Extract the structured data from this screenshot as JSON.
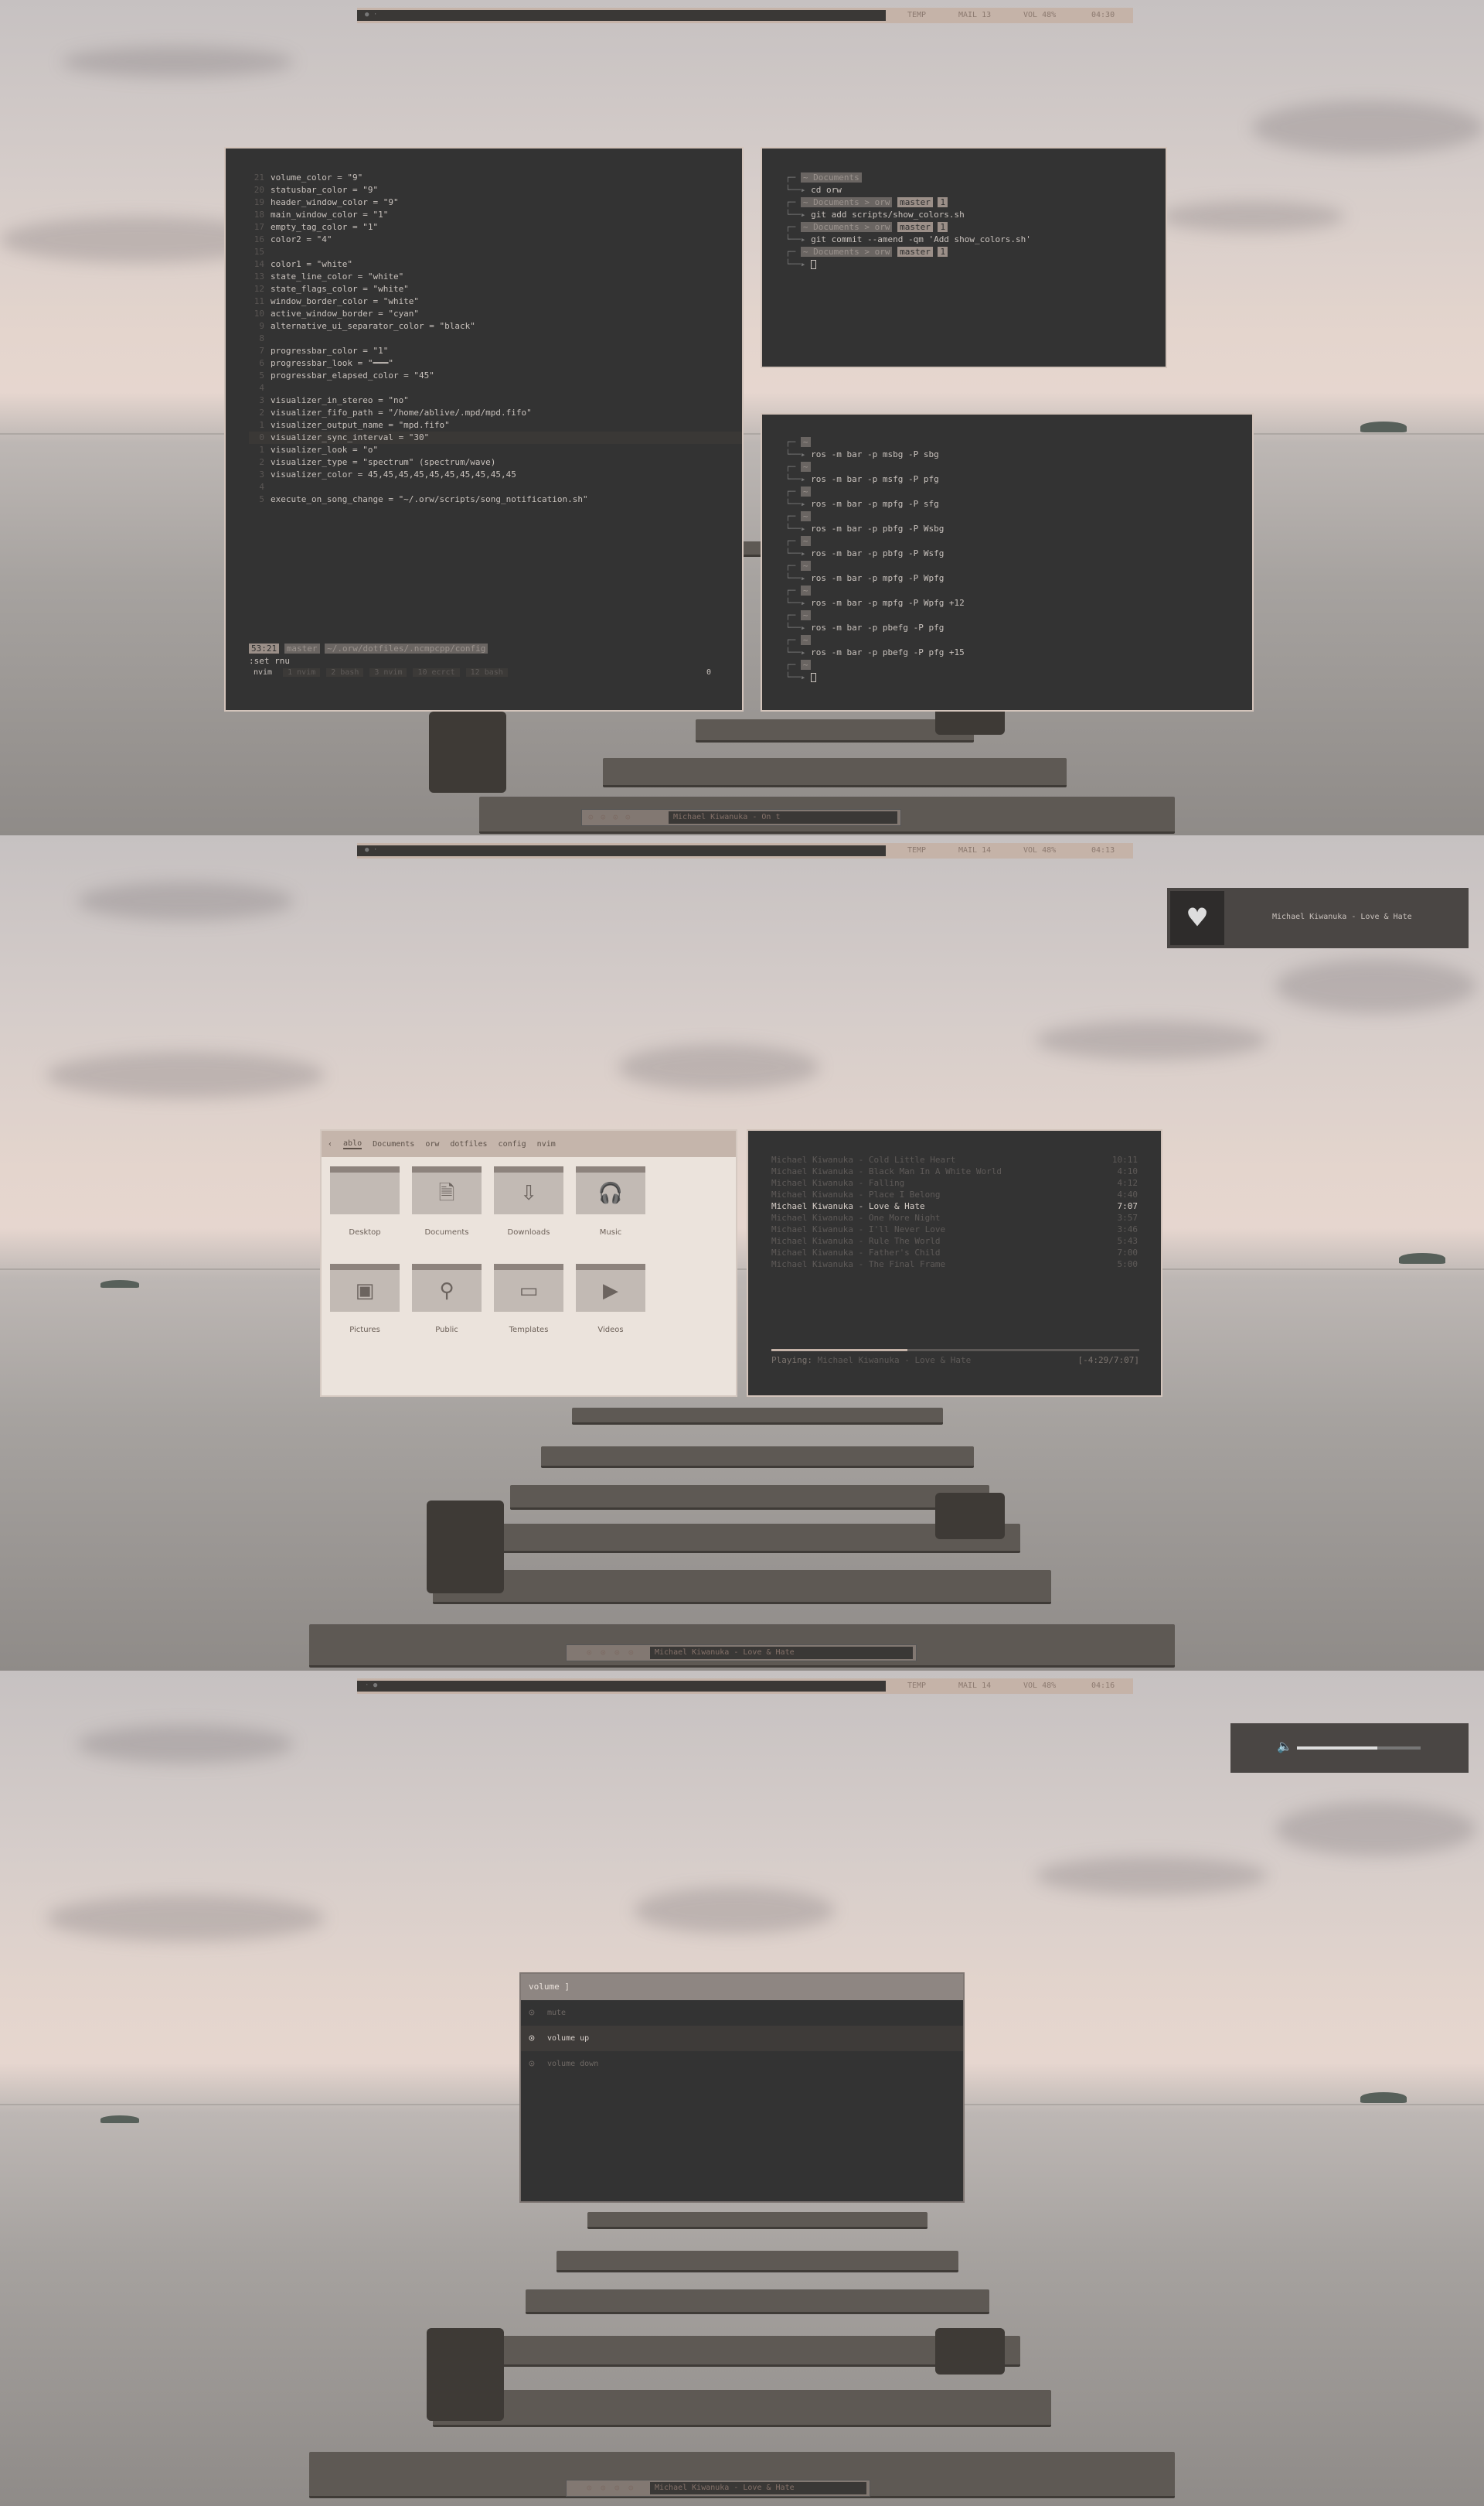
{
  "colors": {
    "accent": "#c5b3a8",
    "terminal_bg": "#333333",
    "border": "#d3c4bb"
  },
  "shot1": {
    "bar": {
      "temp": "TEMP",
      "mail": "MAIL 13",
      "vol": "VOL 48%",
      "time": "04:30"
    },
    "editor": {
      "lines": [
        {
          "n": "21",
          "t": "volume_color = \"9\""
        },
        {
          "n": "20",
          "t": "statusbar_color = \"9\""
        },
        {
          "n": "19",
          "t": "header_window_color = \"9\""
        },
        {
          "n": "18",
          "t": "main_window_color = \"1\""
        },
        {
          "n": "17",
          "t": "empty_tag_color = \"1\""
        },
        {
          "n": "16",
          "t": "color2 = \"4\""
        },
        {
          "n": "15",
          "t": ""
        },
        {
          "n": "14",
          "t": "color1 = \"white\""
        },
        {
          "n": "13",
          "t": "state_line_color = \"white\""
        },
        {
          "n": "12",
          "t": "state_flags_color = \"white\""
        },
        {
          "n": "11",
          "t": "window_border_color = \"white\""
        },
        {
          "n": "10",
          "t": "active_window_border = \"cyan\""
        },
        {
          "n": "9",
          "t": "alternative_ui_separator_color = \"black\""
        },
        {
          "n": "8",
          "t": ""
        },
        {
          "n": "7",
          "t": "progressbar_color = \"1\""
        },
        {
          "n": "6",
          "t": "progressbar_look = \"━━━\""
        },
        {
          "n": "5",
          "t": "progressbar_elapsed_color = \"45\""
        },
        {
          "n": "4",
          "t": ""
        },
        {
          "n": "3",
          "t": "visualizer_in_stereo = \"no\""
        },
        {
          "n": "2",
          "t": "visualizer_fifo_path = \"/home/ablive/.mpd/mpd.fifo\""
        },
        {
          "n": "1",
          "t": "visualizer_output_name = \"mpd.fifo\""
        },
        {
          "n": "0",
          "t": "visualizer_sync_interval = \"30\""
        },
        {
          "n": "1",
          "t": "visualizer_look = \"o\""
        },
        {
          "n": "2",
          "t": "visualizer_type = \"spectrum\" (spectrum/wave)"
        },
        {
          "n": "3",
          "t": "visualizer_color = 45,45,45,45,45,45,45,45,45,45"
        },
        {
          "n": "4",
          "t": ""
        },
        {
          "n": "5",
          "t": "execute_on_song_change = \"~/.orw/scripts/song_notification.sh\""
        }
      ],
      "status_pos": "53:21",
      "status_branch": "master",
      "status_path": "~/.orw/dotfiles/.ncmpcpp/config",
      "cmd": ":set rnu",
      "tabs": [
        "nvim",
        "1 nvim",
        "2 bash",
        "3 nvim",
        "10 ecrct",
        "12 bash"
      ],
      "tab_right": "0"
    },
    "git": {
      "lines": [
        {
          "p": "~ Documents",
          "c": "cd orw"
        },
        {
          "p": "~ Documents > orw",
          "b": "master",
          "x": "1",
          "c": "git add scripts/show_colors.sh"
        },
        {
          "p": "~ Documents > orw",
          "b": "master",
          "x": "1",
          "c": "git commit --amend -qm 'Add show_colors.sh'"
        },
        {
          "p": "~ Documents > orw",
          "b": "master",
          "x": "1",
          "c": ""
        }
      ]
    },
    "ros": {
      "cmds": [
        "ros -m bar -p msbg -P sbg",
        "ros -m bar -p msfg -P pfg",
        "ros -m bar -p mpfg -P sfg",
        "ros -m bar -p pbfg -P Wsbg",
        "ros -m bar -p pbfg -P Wsfg",
        "ros -m bar -p mpfg -P Wpfg",
        "ros -m bar -p mpfg -P Wpfg +12",
        "ros -m bar -p pbefg -P pfg",
        "ros -m bar -p pbefg -P pfg +15",
        ""
      ],
      "prompt": "~"
    },
    "dock": "Michael Kiwanuka - On t"
  },
  "shot2": {
    "bar": {
      "temp": "TEMP",
      "mail": "MAIL 14",
      "vol": "VOL 48%",
      "time": "04:13"
    },
    "notif": {
      "artist": "Michael Kiwanuka",
      "title": "Love & Hate"
    },
    "fm": {
      "crumbs": [
        "‹",
        "ablo",
        "Documents",
        "orw",
        "dotfiles",
        "config",
        "nvim"
      ],
      "folders": [
        {
          "name": "Desktop",
          "icon": ""
        },
        {
          "name": "Documents",
          "icon": "🗎"
        },
        {
          "name": "Downloads",
          "icon": "⇩"
        },
        {
          "name": "Music",
          "icon": "🎧"
        },
        {
          "name": "Pictures",
          "icon": "▣"
        },
        {
          "name": "Public",
          "icon": "⚲"
        },
        {
          "name": "Templates",
          "icon": "▭"
        },
        {
          "name": "Videos",
          "icon": "▶"
        }
      ]
    },
    "playlist": {
      "tracks": [
        {
          "t": "Michael Kiwanuka - Cold Little Heart",
          "d": "10:11"
        },
        {
          "t": "Michael Kiwanuka - Black Man In A White World",
          "d": "4:10"
        },
        {
          "t": "Michael Kiwanuka - Falling",
          "d": "4:12"
        },
        {
          "t": "Michael Kiwanuka - Place I Belong",
          "d": "4:40"
        },
        {
          "t": "Michael Kiwanuka - Love & Hate",
          "d": "7:07",
          "cur": true
        },
        {
          "t": "Michael Kiwanuka - One More Night",
          "d": "3:57"
        },
        {
          "t": "Michael Kiwanuka - I'll Never Love",
          "d": "3:46"
        },
        {
          "t": "Michael Kiwanuka - Rule The World",
          "d": "5:43"
        },
        {
          "t": "Michael Kiwanuka - Father's Child",
          "d": "7:00"
        },
        {
          "t": "Michael Kiwanuka - The Final Frame",
          "d": "5:00"
        }
      ],
      "playing_label": "Playing:",
      "playing": "Michael Kiwanuka - Love & Hate",
      "time": "[-4:29/7:07]",
      "progress": 0.37
    },
    "dock": "Michael Kiwanuka - Love & Hate"
  },
  "shot3": {
    "bar": {
      "temp": "TEMP",
      "mail": "MAIL 14",
      "vol": "VOL 48%",
      "time": "04:16"
    },
    "volume_level": 0.65,
    "rofi": {
      "prompt": "volume ]",
      "options": [
        "mute",
        "volume up",
        "volume down"
      ],
      "selected": 1
    },
    "dock": "Michael Kiwanuka - Love & Hate"
  }
}
